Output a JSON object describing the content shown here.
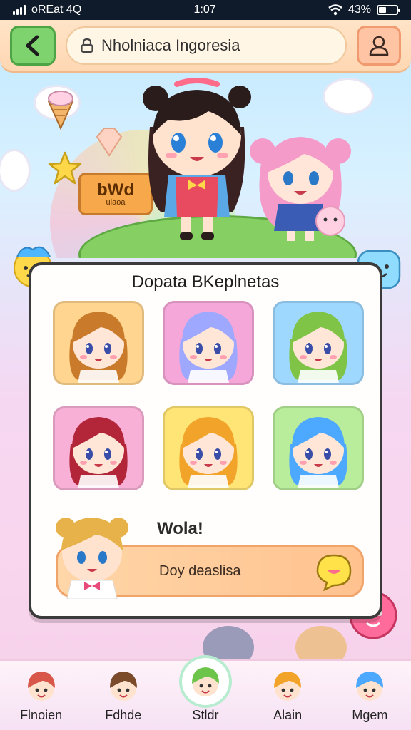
{
  "status": {
    "carrier": "oREat 4Q",
    "time": "1:07",
    "battery": "43%",
    "battery_level": 0.43
  },
  "header": {
    "back_icon": "chevron-left-icon",
    "search": {
      "value": "Nholniaca Ingoresia",
      "icon": "lock-icon"
    },
    "profile_icon": "user-icon"
  },
  "hero": {
    "sign_text": "bWd",
    "sign_sub": "ulaoa"
  },
  "card": {
    "title": "Dopata BKeplnetas",
    "tiles": [
      {
        "name": "brown-bear-girl",
        "bg": "#ffd58f"
      },
      {
        "name": "lavender-twin-tail-girl",
        "bg": "#f6a7d9"
      },
      {
        "name": "green-hair-bow-girl",
        "bg": "#9fd8ff"
      },
      {
        "name": "red-hair-girl",
        "bg": "#f8b0d6"
      },
      {
        "name": "orange-twin-tail-girl",
        "bg": "#ffe476"
      },
      {
        "name": "blue-hair-bow-girl",
        "bg": "#b9ec9b"
      }
    ],
    "chat": {
      "name": "Wola!",
      "message": "Doy deaslisa",
      "send_icon": "chat-send-icon"
    }
  },
  "nav": [
    {
      "label": "Flnoien",
      "icon": "red-hair-avatar-icon",
      "active": false
    },
    {
      "label": "Fdhde",
      "icon": "brown-bear-avatar-icon",
      "active": false
    },
    {
      "label": "Stldr",
      "icon": "green-hair-avatar-icon",
      "active": true
    },
    {
      "label": "Alain",
      "icon": "orange-avatar-icon",
      "active": false
    },
    {
      "label": "Mgem",
      "icon": "blue-hair-avatar-icon",
      "active": false
    }
  ],
  "colors": {
    "header": "#ffd7b3",
    "back": "#7fd36f",
    "profile": "#ffc4a3",
    "bubble": "#ffc28f"
  }
}
